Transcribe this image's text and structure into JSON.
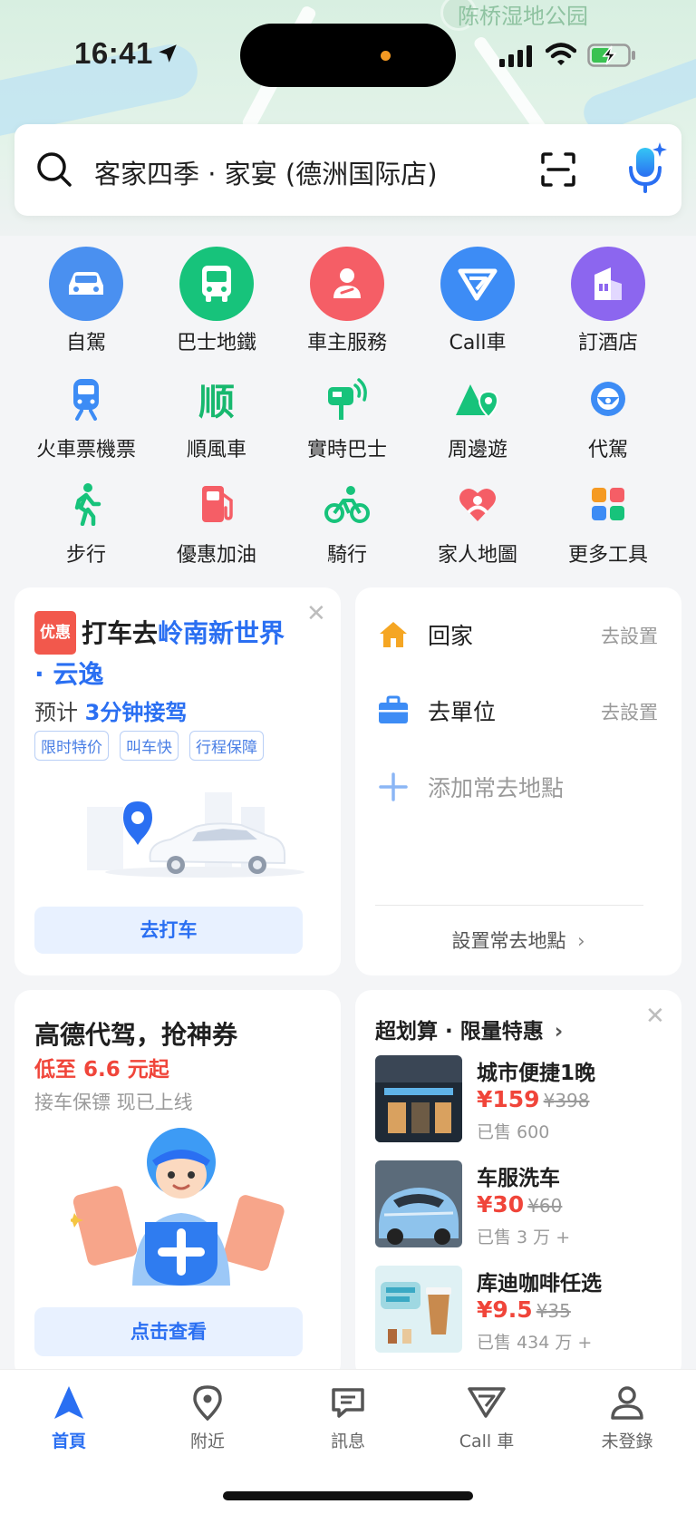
{
  "status": {
    "time": "16:41"
  },
  "map": {
    "label": "陈桥湿地公园"
  },
  "search": {
    "text": "客家四季 · 家宴 (德洲国际店)"
  },
  "tools": {
    "row1": [
      {
        "label": "自駕",
        "color": "#4a90f0"
      },
      {
        "label": "巴士地鐵",
        "color": "#17c37b"
      },
      {
        "label": "車主服務",
        "color": "#f55e66"
      },
      {
        "label": "Call車",
        "color": "#3d8cf5"
      },
      {
        "label": "訂酒店",
        "color": "#8c66ef"
      }
    ],
    "row2": [
      {
        "label": "火車票機票"
      },
      {
        "label": "順風車",
        "glyph": "顺"
      },
      {
        "label": "實時巴士"
      },
      {
        "label": "周邊遊"
      },
      {
        "label": "代駕"
      }
    ],
    "row3": [
      {
        "label": "步行"
      },
      {
        "label": "優惠加油"
      },
      {
        "label": "騎行"
      },
      {
        "label": "家人地圖"
      },
      {
        "label": "更多工具"
      }
    ]
  },
  "ride_card": {
    "badge": "优惠",
    "title_prefix": "打车去",
    "destination": "岭南新世界 · 云逸",
    "eta_prefix": "预计",
    "eta_value": "3分钟接驾",
    "tags": [
      "限时特价",
      "叫车快",
      "行程保障"
    ],
    "button": "去打车"
  },
  "places_card": {
    "home_label": "回家",
    "home_action": "去設置",
    "work_label": "去單位",
    "work_action": "去設置",
    "add_label": "添加常去地點",
    "footer": "設置常去地點"
  },
  "driver_card": {
    "title": "高德代驾，抢神券",
    "subtitle": "低至 6.6 元起",
    "desc": "接车保镖 现已上线",
    "button": "点击查看"
  },
  "deals_card": {
    "heading": "超划算 · 限量特惠",
    "items": [
      {
        "name": "城市便捷1晚",
        "price": "¥159",
        "old_price": "¥398",
        "sold": "已售 600"
      },
      {
        "name": "车服洗车",
        "price": "¥30",
        "old_price": "¥60",
        "sold": "已售 3 万 +"
      },
      {
        "name": "库迪咖啡任选",
        "price": "¥9.5",
        "old_price": "¥35",
        "sold": "已售 434 万 +"
      }
    ]
  },
  "tabs": [
    {
      "label": "首頁",
      "active": true
    },
    {
      "label": "附近"
    },
    {
      "label": "訊息"
    },
    {
      "label": "Call 車"
    },
    {
      "label": "未登錄"
    }
  ]
}
